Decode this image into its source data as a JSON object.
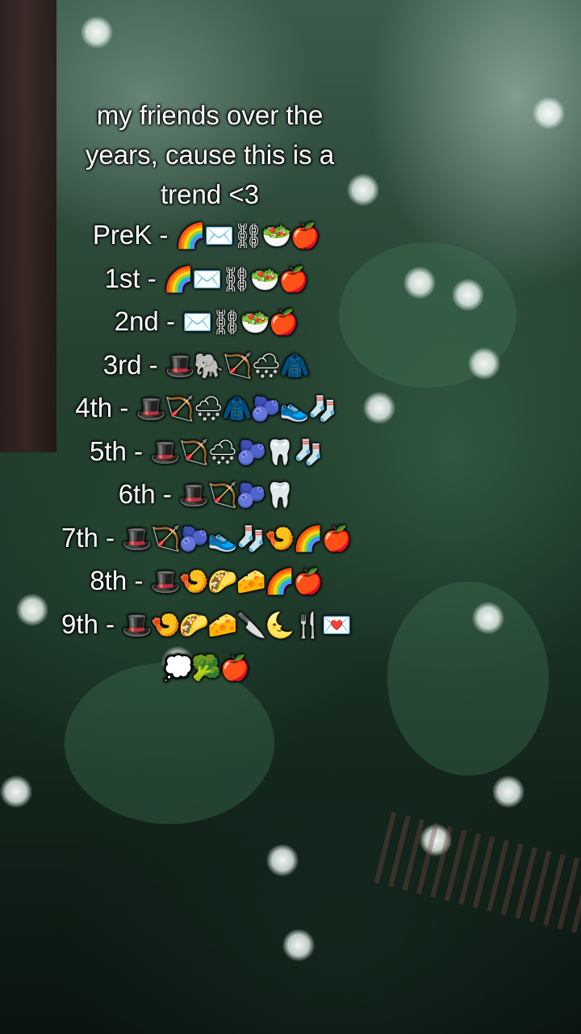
{
  "caption": {
    "title_lines": [
      "my friends over the",
      "years, cause this is a",
      "trend <3"
    ],
    "rows": [
      {
        "grade": "PreK",
        "sep": " - ",
        "emojis": "🌈✉️⛓🥗🍎"
      },
      {
        "grade": "1st",
        "sep": " - ",
        "emojis": "🌈✉️⛓🥗🍎"
      },
      {
        "grade": "2nd",
        "sep": " - ",
        "emojis": "✉️⛓🥗🍎"
      },
      {
        "grade": "3rd",
        "sep": " - ",
        "emojis": "🎩🐘🏹🌨🧥"
      },
      {
        "grade": "4th",
        "sep": " - ",
        "emojis": "🎩🏹🌨🧥🫐👟🧦"
      },
      {
        "grade": "5th",
        "sep": " - ",
        "emojis": "🎩🏹🌨🫐🦷🧦"
      },
      {
        "grade": "6th",
        "sep": " - ",
        "emojis": "🎩🏹🫐🦷"
      },
      {
        "grade": "7th",
        "sep": " - ",
        "emojis": "🎩🏹🫐👟🧦🍤🌈🍎"
      },
      {
        "grade": "8th",
        "sep": " - ",
        "emojis": "🎩🍤🌮🧀🌈🍎"
      },
      {
        "grade": "9th",
        "sep": " - ",
        "emojis": "🎩🍤🌮🧀🔪🌜🍴💌"
      },
      {
        "grade": "",
        "sep": "",
        "emojis": "💭🥦🍎"
      }
    ]
  }
}
